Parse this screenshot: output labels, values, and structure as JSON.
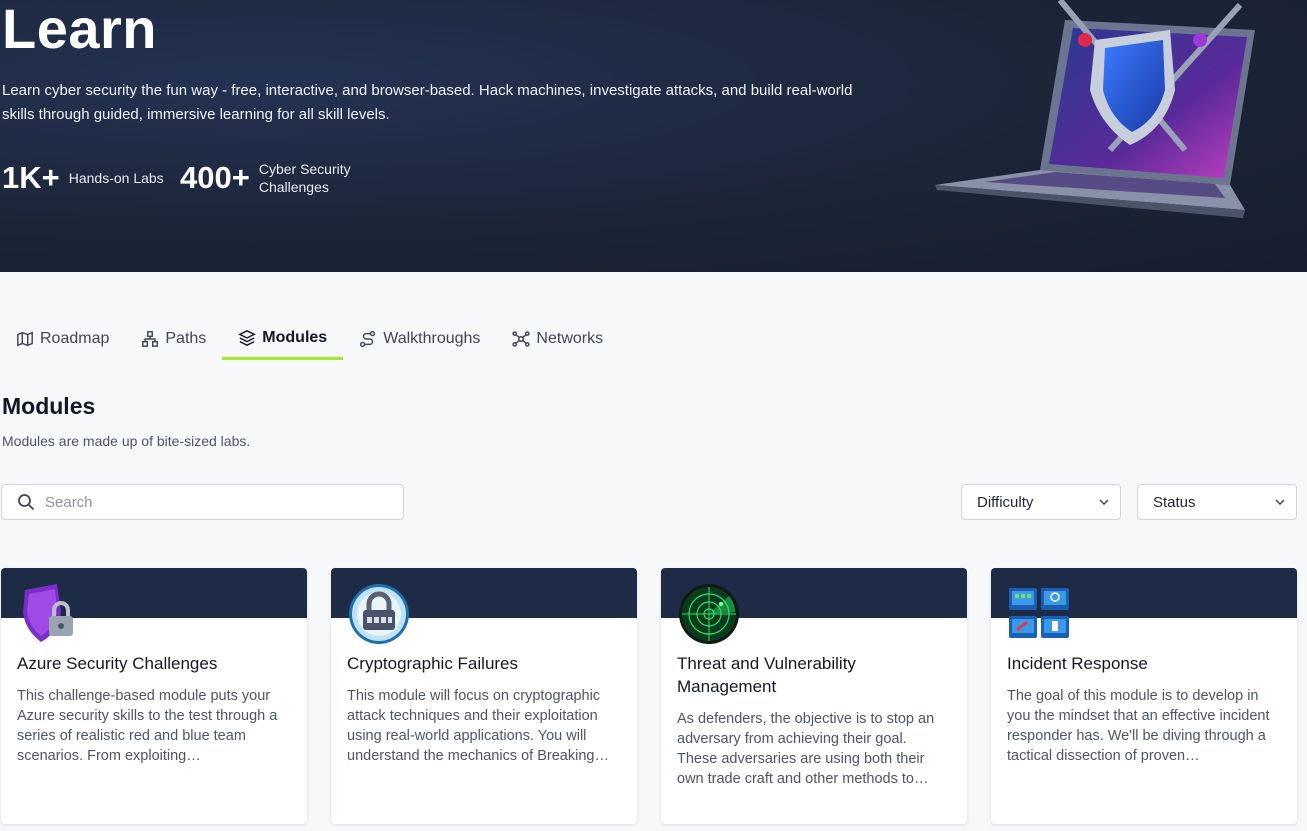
{
  "hero": {
    "title": "Learn",
    "description": "Learn cyber security the fun way - free, interactive, and browser-based. Hack machines, investigate attacks, and build real-world skills through guided, immersive learning for all skill levels.",
    "stats": [
      {
        "value": "1K+",
        "label": "Hands-on Labs"
      },
      {
        "value": "400+",
        "label": "Cyber Security Challenges"
      }
    ]
  },
  "tabs": [
    {
      "label": "Roadmap",
      "icon": "map-icon"
    },
    {
      "label": "Paths",
      "icon": "hierarchy-icon"
    },
    {
      "label": "Modules",
      "icon": "layers-icon",
      "active": true
    },
    {
      "label": "Walkthroughs",
      "icon": "route-icon"
    },
    {
      "label": "Networks",
      "icon": "network-icon"
    }
  ],
  "section": {
    "title": "Modules",
    "subtitle": "Modules are made up of bite-sized labs."
  },
  "search": {
    "placeholder": "Search",
    "value": ""
  },
  "filters": {
    "difficulty": "Difficulty",
    "status": "Status"
  },
  "cards": [
    {
      "title": "Azure Security Challenges",
      "icon": "shield-lock-icon",
      "description": "This challenge-based module puts your Azure security skills to the test through a series of realistic red and blue team scenarios. From exploiting…"
    },
    {
      "title": "Cryptographic Failures",
      "icon": "padlock-icon",
      "description": "This module will focus on cryptographic attack techniques and their exploitation using real-world applications. You will understand the mechanics of Breaking…"
    },
    {
      "title": "Threat and Vulnerability Management",
      "icon": "radar-icon",
      "description": "As defenders, the objective is to stop an adversary from achieving their goal. These adversaries are using both their own trade craft and other methods to…"
    },
    {
      "title": "Incident Response",
      "icon": "monitors-icon",
      "description": "The goal of this module is to develop in you the mindset that an effective incident responder has. We'll be diving through a tactical dissection of proven…"
    }
  ],
  "colors": {
    "hero_bg": "#1c2538",
    "accent": "#a3ea2a",
    "card_band": "#1e2b47"
  }
}
